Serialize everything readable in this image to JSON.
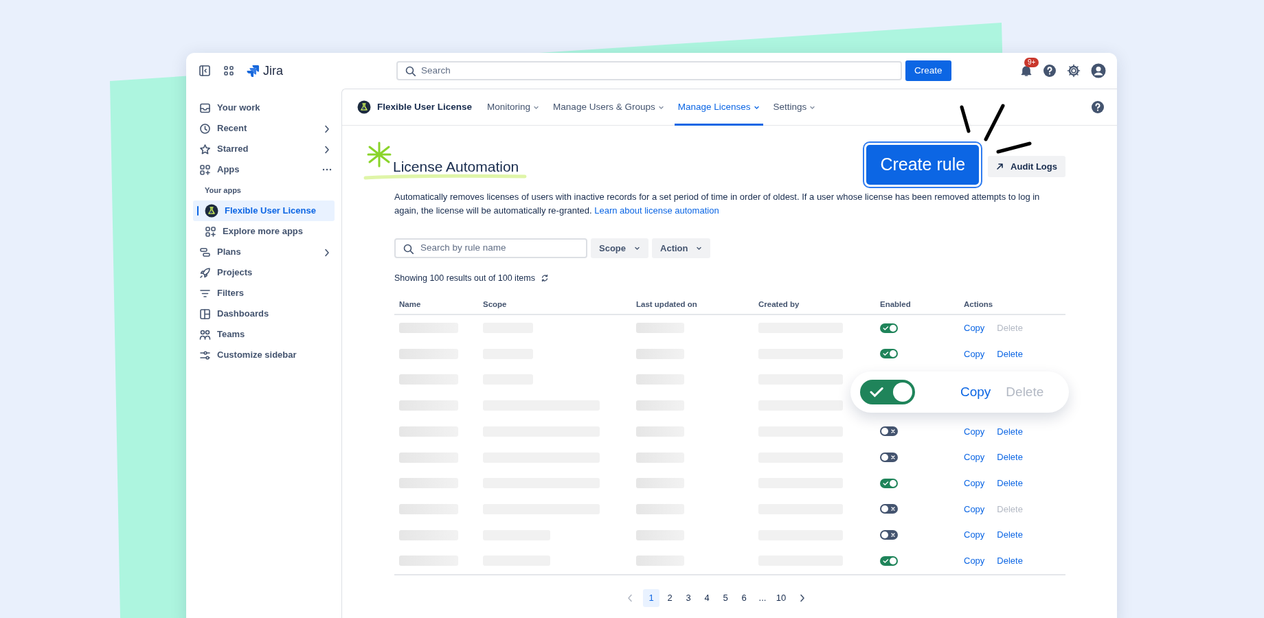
{
  "topbar": {
    "product": "Jira",
    "search": {
      "placeholder": "Search"
    },
    "create_button": "Create",
    "notification_badge": "9+"
  },
  "sidebar": {
    "items": [
      {
        "label": "Your work",
        "kind": "link",
        "selected": false
      },
      {
        "label": "Recent",
        "kind": "expandable",
        "selected": false
      },
      {
        "label": "Starred",
        "kind": "expandable",
        "selected": false
      },
      {
        "label": "Apps",
        "kind": "more",
        "selected": false
      },
      {
        "label": "Your apps",
        "kind": "heading",
        "selected": false
      },
      {
        "label": "Flexible User License",
        "kind": "app",
        "selected": true
      },
      {
        "label": "Explore more apps",
        "kind": "subitem",
        "selected": false
      },
      {
        "label": "Plans",
        "kind": "expandable",
        "selected": false
      },
      {
        "label": "Projects",
        "kind": "link",
        "selected": false
      },
      {
        "label": "Filters",
        "kind": "link",
        "selected": false
      },
      {
        "label": "Dashboards",
        "kind": "link",
        "selected": false
      },
      {
        "label": "Teams",
        "kind": "link",
        "selected": false
      },
      {
        "label": "Customize sidebar",
        "kind": "link",
        "selected": false
      }
    ]
  },
  "app_nav": {
    "app_name": "Flexible User License",
    "tabs": [
      {
        "label": "Monitoring",
        "selected": false
      },
      {
        "label": "Manage Users & Groups",
        "selected": false
      },
      {
        "label": "Manage Licenses",
        "selected": true
      },
      {
        "label": "Settings",
        "selected": false
      }
    ]
  },
  "page": {
    "title": "License Automation",
    "create_rule": "Create rule",
    "audit_logs": "Audit Logs",
    "description": {
      "text": "Automatically removes licenses of users with inactive records for a set period of time in order of oldest. If a user whose license has been removed attempts to log in again, the license will be automatically re-granted.",
      "link": "Learn about license automation"
    },
    "filters": {
      "search_placeholder": "Search by rule name",
      "dropdowns": [
        "Scope",
        "Action"
      ]
    },
    "results": "Showing 100 results out of 100 items"
  },
  "table": {
    "columns": [
      "Name",
      "Scope",
      "Last updated on",
      "Created by",
      "Enabled",
      "Actions"
    ],
    "rows": [
      {
        "kind": "loading",
        "enabled": true,
        "copy": "Copy",
        "delete": "Delete",
        "delete_disabled": true
      },
      {
        "kind": "loading",
        "enabled": true,
        "copy": "Copy",
        "delete": "Delete",
        "delete_disabled": false
      },
      {
        "kind": "loading"
      },
      {
        "kind": "loading"
      },
      {
        "kind": "loading",
        "enabled": false,
        "copy": "Copy",
        "delete": "Delete",
        "delete_disabled": false
      },
      {
        "kind": "loading",
        "enabled": false,
        "copy": "Copy",
        "delete": "Delete",
        "delete_disabled": false
      },
      {
        "kind": "loading",
        "enabled": true,
        "copy": "Copy",
        "delete": "Delete",
        "delete_disabled": false
      },
      {
        "kind": "loading",
        "enabled": false,
        "copy": "Copy",
        "delete": "Delete",
        "delete_disabled": true
      },
      {
        "kind": "loading",
        "enabled": false,
        "copy": "Copy",
        "delete": "Delete",
        "delete_disabled": false
      },
      {
        "kind": "loading",
        "enabled": true,
        "copy": "Copy",
        "delete": "Delete",
        "delete_disabled": false
      }
    ]
  },
  "spotlight": {
    "enabled": true,
    "copy": "Copy",
    "delete": "Delete",
    "delete_disabled": true
  },
  "pagination": [
    {
      "label": "1",
      "selected": true
    },
    {
      "label": "2",
      "selected": false
    },
    {
      "label": "3",
      "selected": false
    },
    {
      "label": "4",
      "selected": false
    },
    {
      "label": "5",
      "selected": false
    },
    {
      "label": "6",
      "selected": false
    },
    {
      "label": "...",
      "selected": false
    },
    {
      "label": "10",
      "selected": false
    }
  ]
}
